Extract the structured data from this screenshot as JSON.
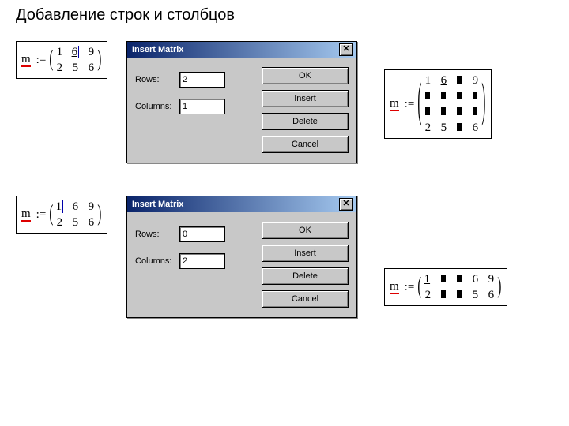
{
  "page_title": "Добавление строк и столбцов",
  "matrix1": {
    "var": "m",
    "assign": ":=",
    "rows": [
      [
        "1",
        "6",
        "9"
      ],
      [
        "2",
        "5",
        "6"
      ]
    ],
    "underline_cell": [
      0,
      1
    ]
  },
  "matrix2": {
    "var": "m",
    "assign": ":=",
    "rows": [
      [
        "1",
        "6",
        "■",
        "9"
      ],
      [
        "■",
        "■",
        "■",
        "■"
      ],
      [
        "■",
        "■",
        "■",
        "■"
      ],
      [
        "2",
        "5",
        "■",
        "6"
      ]
    ],
    "underline_cell": [
      0,
      1
    ]
  },
  "matrix3": {
    "var": "m",
    "assign": ":=",
    "rows": [
      [
        "1",
        "6",
        "9"
      ],
      [
        "2",
        "5",
        "6"
      ]
    ],
    "underline_cell": [
      0,
      0
    ]
  },
  "matrix4": {
    "var": "m",
    "assign": ":=",
    "rows": [
      [
        "1",
        "■",
        "■",
        "6",
        "9"
      ],
      [
        "2",
        "■",
        "■",
        "5",
        "6"
      ]
    ],
    "underline_cell": [
      0,
      0
    ]
  },
  "dialog1": {
    "title": "Insert Matrix",
    "rows_label": "Rows:",
    "rows_value": "2",
    "cols_label": "Columns:",
    "cols_value": "1",
    "ok": "OK",
    "insert": "Insert",
    "delete": "Delete",
    "cancel": "Cancel"
  },
  "dialog2": {
    "title": "Insert Matrix",
    "rows_label": "Rows:",
    "rows_value": "0",
    "cols_label": "Columns:",
    "cols_value": "2",
    "ok": "OK",
    "insert": "Insert",
    "delete": "Delete",
    "cancel": "Cancel"
  }
}
